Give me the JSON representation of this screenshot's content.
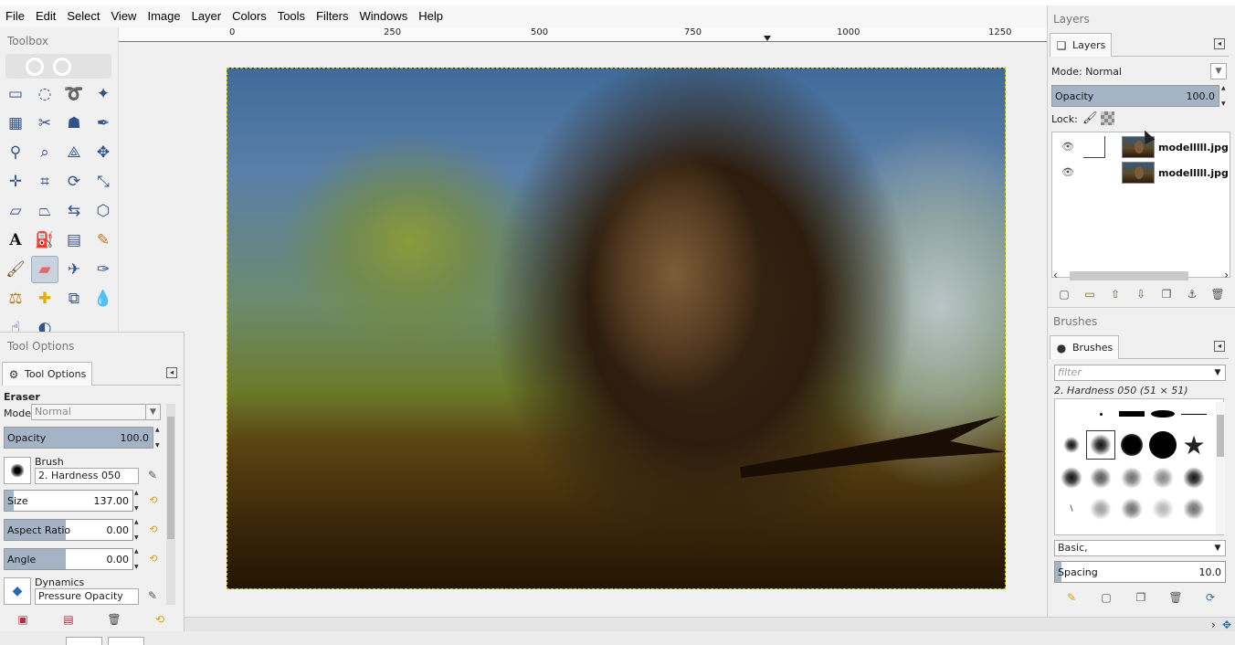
{
  "menubar": {
    "items": [
      "File",
      "Edit",
      "Select",
      "View",
      "Image",
      "Layer",
      "Colors",
      "Tools",
      "Filters",
      "Windows",
      "Help"
    ]
  },
  "ruler": {
    "labels": [
      "0",
      "250",
      "500",
      "750",
      "1000",
      "1250"
    ]
  },
  "toolbox": {
    "title": "Toolbox",
    "tools": [
      "rect-select-icon",
      "ellipse-select-icon",
      "free-select-icon",
      "fuzzy-select-icon",
      "by-color-select-icon",
      "scissors-select-icon",
      "foreground-select-icon",
      "paths-icon",
      "color-picker-icon",
      "zoom-icon",
      "measure-icon",
      "move-icon",
      "align-icon",
      "crop-icon",
      "unified-transform-icon",
      "scale-icon",
      "shear-icon",
      "perspective-icon",
      "flip-icon",
      "cage-icon",
      "text-icon",
      "bucket-fill-icon",
      "gradient-icon",
      "pencil-icon",
      "paintbrush-icon",
      "eraser-icon",
      "airbrush-icon",
      "ink-icon",
      "clone-icon",
      "heal-icon",
      "perspective-clone-icon",
      "blur-icon",
      "smudge-icon",
      "dodge-icon"
    ]
  },
  "tool_options": {
    "title": "Tool Options",
    "tab_label": "Tool Options",
    "tool_name": "Eraser",
    "mode_label": "Mode:",
    "mode_value": "Normal",
    "opacity_label": "Opacity",
    "opacity_value": "100.0",
    "brush_label": "Brush",
    "brush_value": "2. Hardness 050",
    "size_label": "Size",
    "size_value": "137.00",
    "size_fraction": 0.07,
    "aspect_label": "Aspect Ratio",
    "aspect_value": "0.00",
    "angle_label": "Angle",
    "angle_value": "0.00",
    "dynamics_label": "Dynamics",
    "dynamics_value": "Pressure Opacity"
  },
  "layers": {
    "title": "Layers",
    "tab_label": "Layers",
    "mode_label": "Mode:",
    "mode_value": "Normal",
    "opacity_label": "Opacity",
    "opacity_value": "100.0",
    "lock_label": "Lock:",
    "items": [
      {
        "name": "modelllll.jpg co"
      },
      {
        "name": "modelllll.jpg co"
      }
    ]
  },
  "brushes": {
    "title": "Brushes",
    "tab_label": "Brushes",
    "filter_placeholder": "filter",
    "selected_brush": "2. Hardness 050 (51 × 51)",
    "preset_value": "Basic,",
    "spacing_label": "Spacing",
    "spacing_value": "10.0"
  },
  "colors": {
    "accent": "#a4b4c6",
    "selection_border": "#c9c000"
  }
}
